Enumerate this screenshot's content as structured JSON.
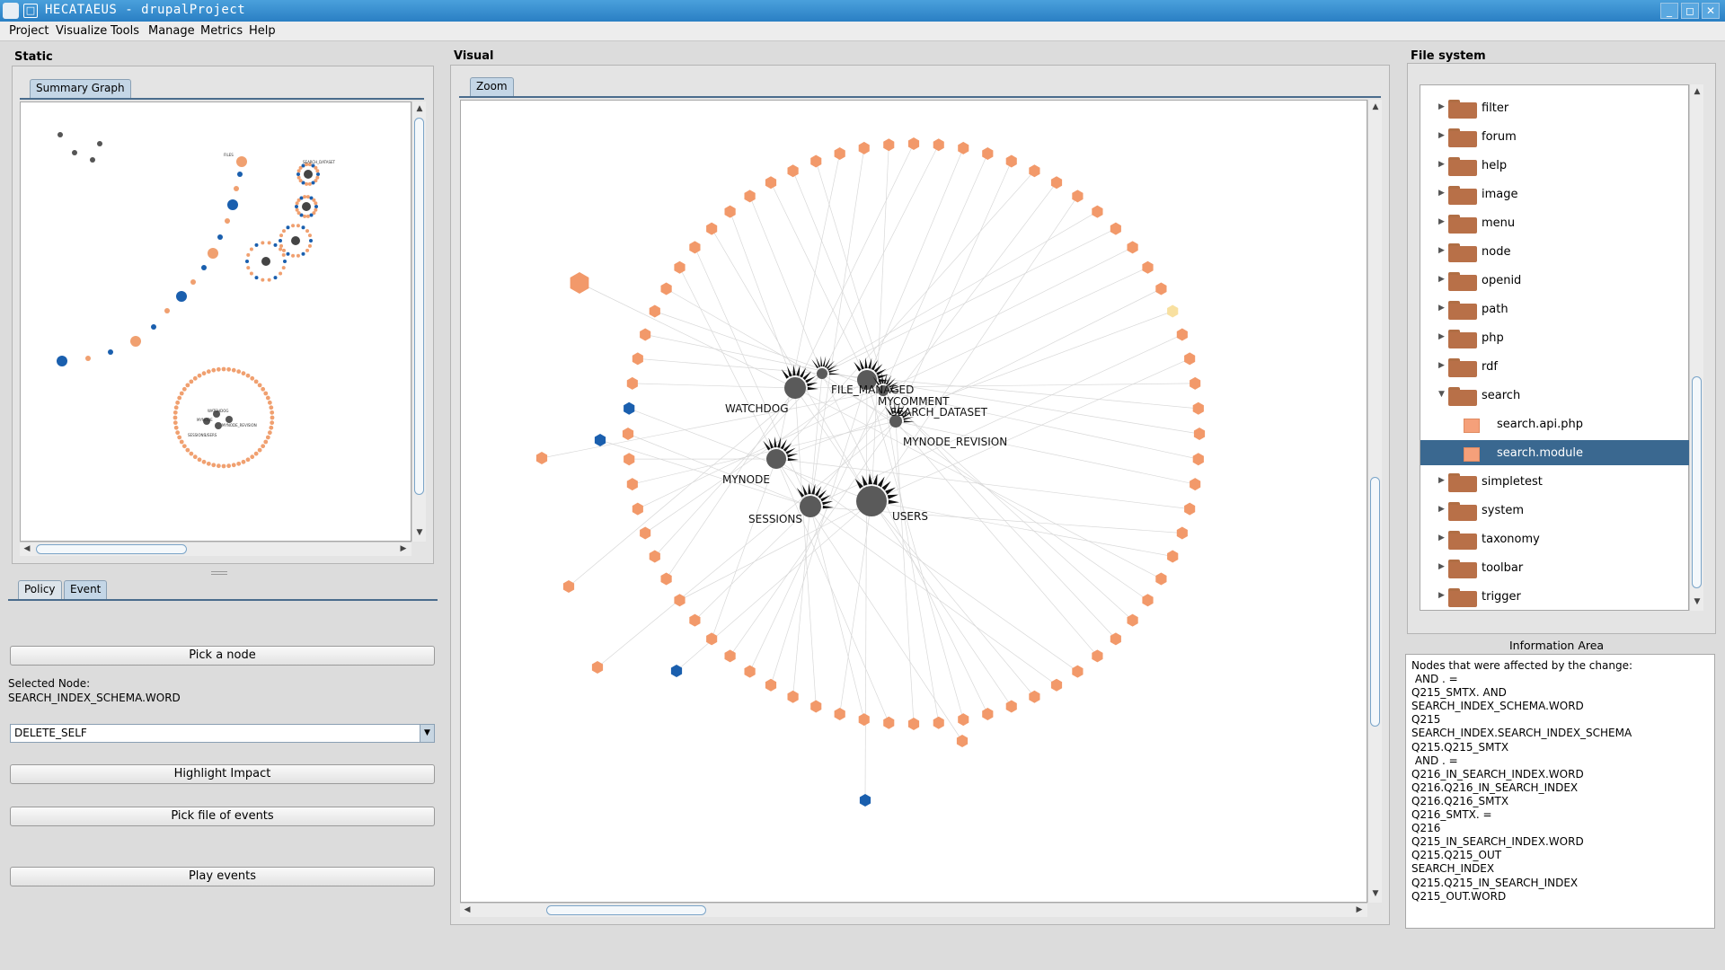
{
  "window": {
    "title": "HECATAEUS - drupalProject",
    "min": "_",
    "max": "◻",
    "close": "✕"
  },
  "menu": [
    "Project",
    "Visualize",
    "Tools",
    "Manage",
    "Metrics",
    "Help"
  ],
  "static_panel": {
    "title": "Static",
    "tab": "Summary Graph",
    "mini_labels": [
      "FILES",
      "SEARCH_DATASET",
      "USERS",
      "MYNODE",
      "SESSIONS",
      "WATCHDOG",
      "MYNODE_REVISION"
    ]
  },
  "event_panel": {
    "tabs": [
      "Policy",
      "Event"
    ],
    "pick_node": "Pick a node",
    "selected_node_label": "Selected Node:",
    "selected_node_value": "SEARCH_INDEX_SCHEMA.WORD",
    "event_value": "DELETE_SELF",
    "highlight": "Highlight Impact",
    "pick_file": "Pick file of events",
    "play": "Play events"
  },
  "visual_panel": {
    "title": "Visual",
    "tab": "Zoom",
    "graph_labels": [
      {
        "text": "WATCHDOG",
        "key": "watchdog"
      },
      {
        "text": "FILE_MANAGED",
        "key": "file-managed"
      },
      {
        "text": "MYCOMMENT",
        "key": "mycomment"
      },
      {
        "text": "SEARCH_DATASET",
        "key": "search-dataset"
      },
      {
        "text": "MYNODE_REVISION",
        "key": "mynode-revision"
      },
      {
        "text": "MYNODE",
        "key": "mynode"
      },
      {
        "text": "SESSIONS",
        "key": "sessions"
      },
      {
        "text": "USERS",
        "key": "users"
      }
    ],
    "colors": {
      "ring_node": "#f2996a",
      "blue_node": "#1a5fae",
      "yellow_node": "#f8e0a0",
      "table_node": "#5a5a5a",
      "edge": "#d8d8d8"
    }
  },
  "filesystem": {
    "title": "File system",
    "items": [
      {
        "name": "filter",
        "kind": "folder"
      },
      {
        "name": "forum",
        "kind": "folder"
      },
      {
        "name": "help",
        "kind": "folder"
      },
      {
        "name": "image",
        "kind": "folder"
      },
      {
        "name": "menu",
        "kind": "folder"
      },
      {
        "name": "node",
        "kind": "folder"
      },
      {
        "name": "openid",
        "kind": "folder"
      },
      {
        "name": "path",
        "kind": "folder"
      },
      {
        "name": "php",
        "kind": "folder"
      },
      {
        "name": "rdf",
        "kind": "folder"
      },
      {
        "name": "search",
        "kind": "folder-open"
      },
      {
        "name": "search.api.php",
        "kind": "file"
      },
      {
        "name": "search.module",
        "kind": "file",
        "selected": true
      },
      {
        "name": "simpletest",
        "kind": "folder"
      },
      {
        "name": "system",
        "kind": "folder"
      },
      {
        "name": "taxonomy",
        "kind": "folder"
      },
      {
        "name": "toolbar",
        "kind": "folder"
      },
      {
        "name": "trigger",
        "kind": "folder"
      }
    ]
  },
  "info": {
    "title": "Information Area",
    "lines": [
      "Nodes that were affected by the change:",
      " AND . =",
      "Q215_SMTX. AND",
      "SEARCH_INDEX_SCHEMA.WORD",
      "Q215",
      "SEARCH_INDEX.SEARCH_INDEX_SCHEMA",
      "Q215.Q215_SMTX",
      " AND . =",
      "Q216_IN_SEARCH_INDEX.WORD",
      "Q216.Q216_IN_SEARCH_INDEX",
      "Q216.Q216_SMTX",
      "Q216_SMTX. =",
      "Q216",
      "Q215_IN_SEARCH_INDEX.WORD",
      "Q215.Q215_OUT",
      "SEARCH_INDEX",
      "Q215.Q215_IN_SEARCH_INDEX",
      "Q215_OUT.WORD"
    ]
  }
}
